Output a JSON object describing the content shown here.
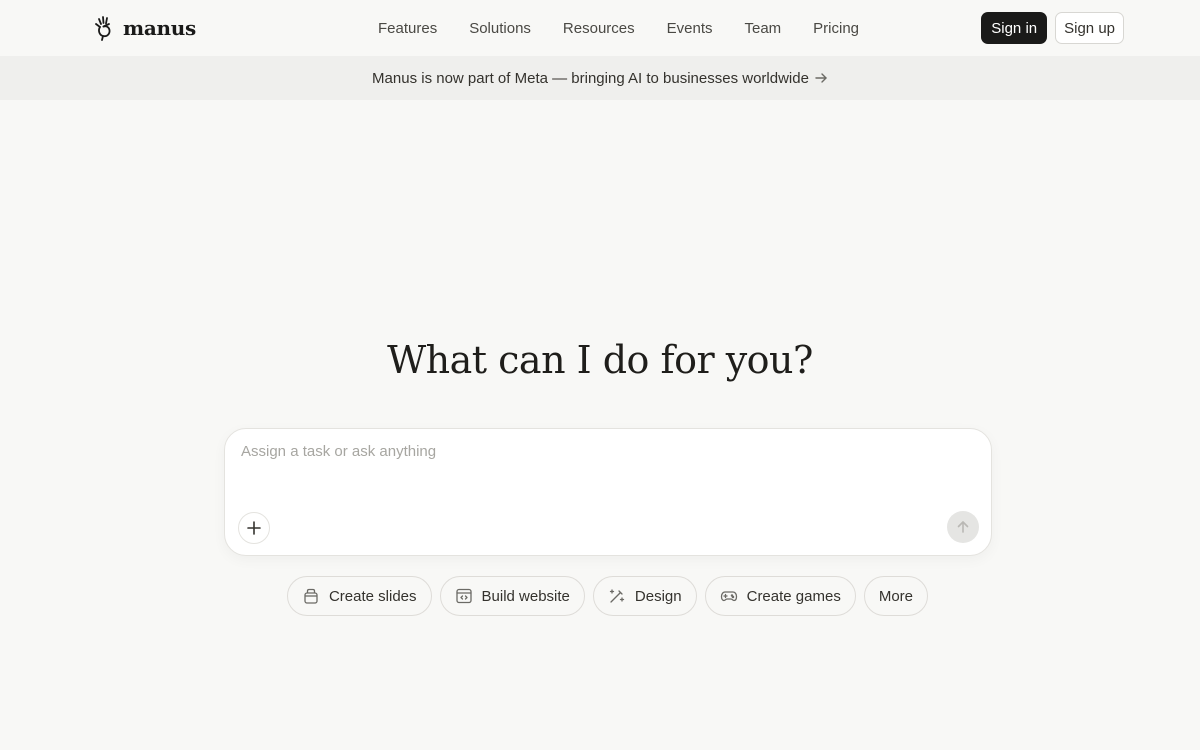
{
  "brand": {
    "name": "manus"
  },
  "nav": {
    "items": [
      "Features",
      "Solutions",
      "Resources",
      "Events",
      "Team",
      "Pricing"
    ]
  },
  "auth": {
    "sign_in": "Sign in",
    "sign_up": "Sign up"
  },
  "banner": {
    "text": "Manus is now part of Meta — bringing AI to businesses worldwide"
  },
  "hero": {
    "title": "What can I do for you?"
  },
  "composer": {
    "placeholder": "Assign a task or ask anything"
  },
  "chips": [
    {
      "label": "Create slides",
      "icon": "slides-icon"
    },
    {
      "label": "Build website",
      "icon": "website-icon"
    },
    {
      "label": "Design",
      "icon": "design-icon"
    },
    {
      "label": "Create games",
      "icon": "gamepad-icon"
    },
    {
      "label": "More",
      "icon": ""
    }
  ],
  "colors": {
    "background": "#f8f8f6",
    "banner": "#efefed",
    "primary_button": "#1a1a19",
    "send_disabled": "#e5e5e3"
  }
}
